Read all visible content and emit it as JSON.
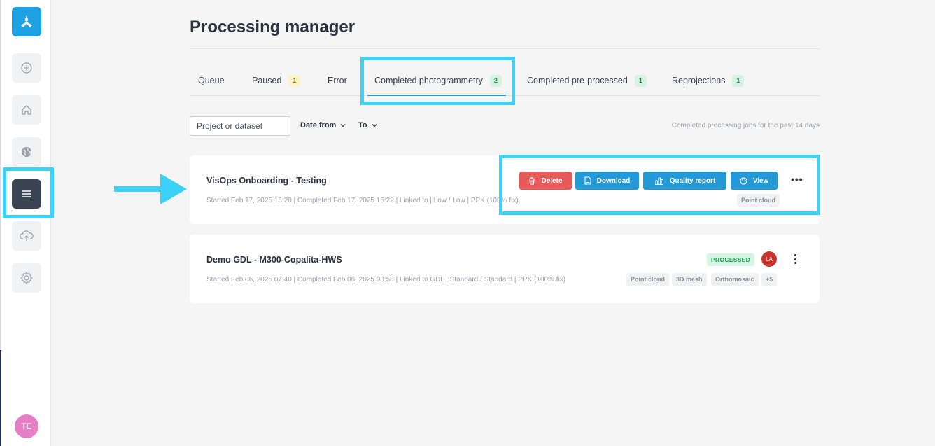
{
  "sidebar": {
    "items": [
      {
        "name": "add",
        "icon": "plus-circle-icon"
      },
      {
        "name": "home",
        "icon": "home-icon"
      },
      {
        "name": "globe",
        "icon": "globe-icon"
      },
      {
        "name": "processing",
        "icon": "menu-icon",
        "active": true
      },
      {
        "name": "upload",
        "icon": "cloud-upload-icon"
      },
      {
        "name": "settings",
        "icon": "gear-icon"
      }
    ],
    "avatar_initials": "TE"
  },
  "page": {
    "title": "Processing manager"
  },
  "tabs": [
    {
      "label": "Queue",
      "count": ""
    },
    {
      "label": "Paused",
      "count": "1"
    },
    {
      "label": "Error",
      "count": ""
    },
    {
      "label": "Completed photogrammetry",
      "count": "2"
    },
    {
      "label": "Completed pre-processed",
      "count": "1"
    },
    {
      "label": "Reprojections",
      "count": "1"
    }
  ],
  "filters": {
    "search_placeholder": "Project or dataset",
    "date_from": "Date from",
    "to": "To",
    "hint": "Completed processing jobs for the past 14 days"
  },
  "jobs": [
    {
      "title": "VisOps Onboarding - Testing",
      "meta": "Started Feb 17, 2025 15:20 | Completed Feb 17, 2025 15:22 | Linked to | Low / Low | PPK (100% fix)",
      "actions": {
        "delete": "Delete",
        "download": "Download",
        "quality": "Quality report",
        "view": "View"
      },
      "tags": [
        "Point cloud"
      ]
    },
    {
      "title": "Demo GDL - M300-Copalita-HWS",
      "meta": "Started Feb 06, 2025 07:40 | Completed Feb 06, 2025 08:58 | Linked to GDL | Standard / Standard | PPK (100% fix)",
      "status": "PROCESSED",
      "user_initials": "LA",
      "tags": [
        "Point cloud",
        "3D mesh",
        "Orthomosaic",
        "+5"
      ]
    }
  ],
  "colors": {
    "accent": "#1da1e3",
    "highlight": "#3cd2f7",
    "delete": "#e85a5a",
    "button": "#2499d6"
  }
}
